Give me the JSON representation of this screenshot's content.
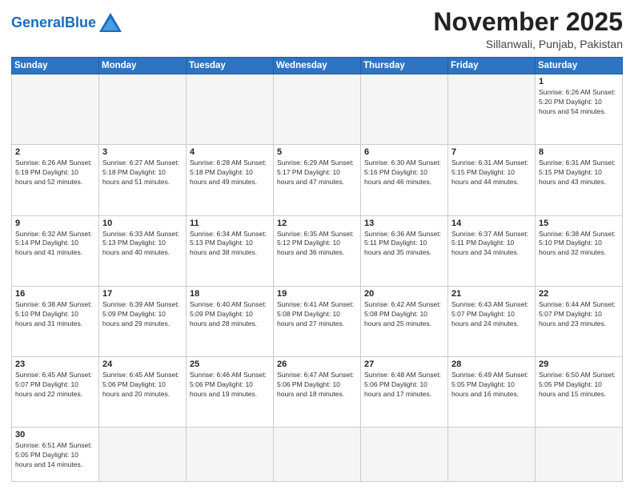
{
  "header": {
    "logo_general": "General",
    "logo_blue": "Blue",
    "month_title": "November 2025",
    "location": "Sillanwali, Punjab, Pakistan"
  },
  "days_of_week": [
    "Sunday",
    "Monday",
    "Tuesday",
    "Wednesday",
    "Thursday",
    "Friday",
    "Saturday"
  ],
  "weeks": [
    [
      {
        "day": "",
        "info": ""
      },
      {
        "day": "",
        "info": ""
      },
      {
        "day": "",
        "info": ""
      },
      {
        "day": "",
        "info": ""
      },
      {
        "day": "",
        "info": ""
      },
      {
        "day": "",
        "info": ""
      },
      {
        "day": "1",
        "info": "Sunrise: 6:26 AM\nSunset: 5:20 PM\nDaylight: 10 hours\nand 54 minutes."
      }
    ],
    [
      {
        "day": "2",
        "info": "Sunrise: 6:26 AM\nSunset: 5:19 PM\nDaylight: 10 hours\nand 52 minutes."
      },
      {
        "day": "3",
        "info": "Sunrise: 6:27 AM\nSunset: 5:18 PM\nDaylight: 10 hours\nand 51 minutes."
      },
      {
        "day": "4",
        "info": "Sunrise: 6:28 AM\nSunset: 5:18 PM\nDaylight: 10 hours\nand 49 minutes."
      },
      {
        "day": "5",
        "info": "Sunrise: 6:29 AM\nSunset: 5:17 PM\nDaylight: 10 hours\nand 47 minutes."
      },
      {
        "day": "6",
        "info": "Sunrise: 6:30 AM\nSunset: 5:16 PM\nDaylight: 10 hours\nand 46 minutes."
      },
      {
        "day": "7",
        "info": "Sunrise: 6:31 AM\nSunset: 5:15 PM\nDaylight: 10 hours\nand 44 minutes."
      },
      {
        "day": "8",
        "info": "Sunrise: 6:31 AM\nSunset: 5:15 PM\nDaylight: 10 hours\nand 43 minutes."
      }
    ],
    [
      {
        "day": "9",
        "info": "Sunrise: 6:32 AM\nSunset: 5:14 PM\nDaylight: 10 hours\nand 41 minutes."
      },
      {
        "day": "10",
        "info": "Sunrise: 6:33 AM\nSunset: 5:13 PM\nDaylight: 10 hours\nand 40 minutes."
      },
      {
        "day": "11",
        "info": "Sunrise: 6:34 AM\nSunset: 5:13 PM\nDaylight: 10 hours\nand 38 minutes."
      },
      {
        "day": "12",
        "info": "Sunrise: 6:35 AM\nSunset: 5:12 PM\nDaylight: 10 hours\nand 36 minutes."
      },
      {
        "day": "13",
        "info": "Sunrise: 6:36 AM\nSunset: 5:11 PM\nDaylight: 10 hours\nand 35 minutes."
      },
      {
        "day": "14",
        "info": "Sunrise: 6:37 AM\nSunset: 5:11 PM\nDaylight: 10 hours\nand 34 minutes."
      },
      {
        "day": "15",
        "info": "Sunrise: 6:38 AM\nSunset: 5:10 PM\nDaylight: 10 hours\nand 32 minutes."
      }
    ],
    [
      {
        "day": "16",
        "info": "Sunrise: 6:38 AM\nSunset: 5:10 PM\nDaylight: 10 hours\nand 31 minutes."
      },
      {
        "day": "17",
        "info": "Sunrise: 6:39 AM\nSunset: 5:09 PM\nDaylight: 10 hours\nand 29 minutes."
      },
      {
        "day": "18",
        "info": "Sunrise: 6:40 AM\nSunset: 5:09 PM\nDaylight: 10 hours\nand 28 minutes."
      },
      {
        "day": "19",
        "info": "Sunrise: 6:41 AM\nSunset: 5:08 PM\nDaylight: 10 hours\nand 27 minutes."
      },
      {
        "day": "20",
        "info": "Sunrise: 6:42 AM\nSunset: 5:08 PM\nDaylight: 10 hours\nand 25 minutes."
      },
      {
        "day": "21",
        "info": "Sunrise: 6:43 AM\nSunset: 5:07 PM\nDaylight: 10 hours\nand 24 minutes."
      },
      {
        "day": "22",
        "info": "Sunrise: 6:44 AM\nSunset: 5:07 PM\nDaylight: 10 hours\nand 23 minutes."
      }
    ],
    [
      {
        "day": "23",
        "info": "Sunrise: 6:45 AM\nSunset: 5:07 PM\nDaylight: 10 hours\nand 22 minutes."
      },
      {
        "day": "24",
        "info": "Sunrise: 6:45 AM\nSunset: 5:06 PM\nDaylight: 10 hours\nand 20 minutes."
      },
      {
        "day": "25",
        "info": "Sunrise: 6:46 AM\nSunset: 5:06 PM\nDaylight: 10 hours\nand 19 minutes."
      },
      {
        "day": "26",
        "info": "Sunrise: 6:47 AM\nSunset: 5:06 PM\nDaylight: 10 hours\nand 18 minutes."
      },
      {
        "day": "27",
        "info": "Sunrise: 6:48 AM\nSunset: 5:06 PM\nDaylight: 10 hours\nand 17 minutes."
      },
      {
        "day": "28",
        "info": "Sunrise: 6:49 AM\nSunset: 5:05 PM\nDaylight: 10 hours\nand 16 minutes."
      },
      {
        "day": "29",
        "info": "Sunrise: 6:50 AM\nSunset: 5:05 PM\nDaylight: 10 hours\nand 15 minutes."
      }
    ],
    [
      {
        "day": "30",
        "info": "Sunrise: 6:51 AM\nSunset: 5:05 PM\nDaylight: 10 hours\nand 14 minutes."
      },
      {
        "day": "",
        "info": ""
      },
      {
        "day": "",
        "info": ""
      },
      {
        "day": "",
        "info": ""
      },
      {
        "day": "",
        "info": ""
      },
      {
        "day": "",
        "info": ""
      },
      {
        "day": "",
        "info": ""
      }
    ]
  ]
}
